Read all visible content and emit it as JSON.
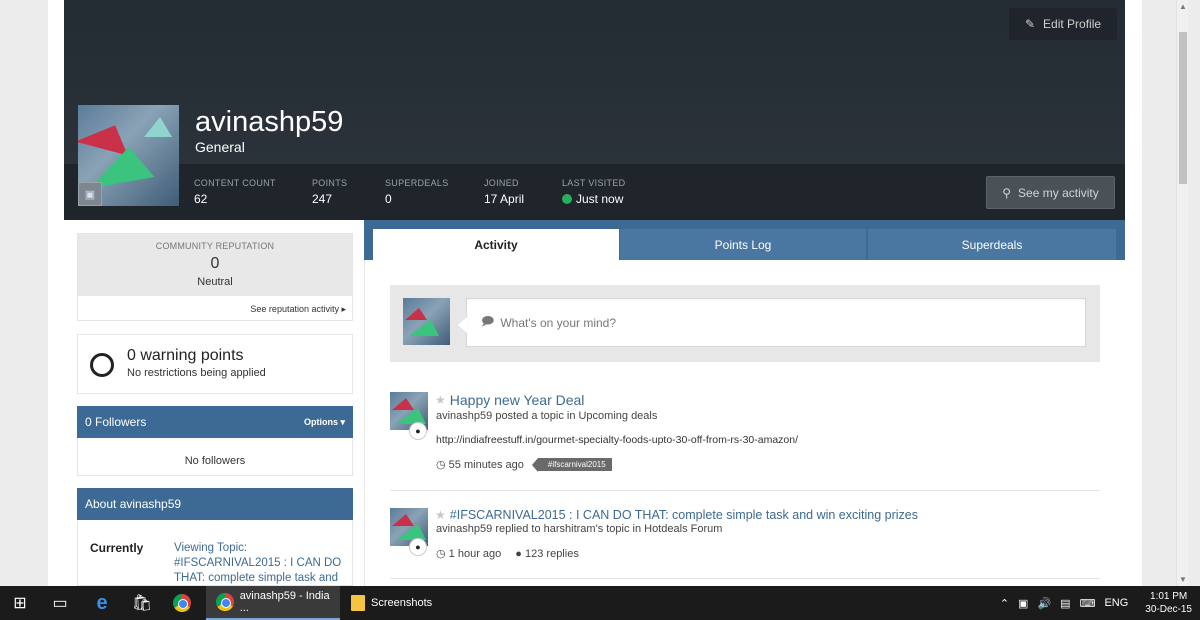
{
  "header": {
    "edit_profile": "Edit Profile",
    "username": "avinashp59",
    "usergroup": "General",
    "stats": [
      {
        "label": "CONTENT COUNT",
        "value": "62"
      },
      {
        "label": "POINTS",
        "value": "247"
      },
      {
        "label": "SUPERDEALS",
        "value": "0"
      },
      {
        "label": "JOINED",
        "value": "17 April"
      },
      {
        "label": "LAST VISITED",
        "value": "Just now"
      }
    ],
    "see_activity": "See my activity"
  },
  "reputation": {
    "title": "COMMUNITY REPUTATION",
    "score": "0",
    "status": "Neutral",
    "link": "See reputation activity ▸"
  },
  "warnings": {
    "title": "0 warning points",
    "subtitle": "No restrictions being applied"
  },
  "followers": {
    "title": "0 Followers",
    "options": "Options ▾",
    "empty": "No followers"
  },
  "about": {
    "title": "About avinashp59",
    "label": "Currently",
    "value": "Viewing Topic: #IFSCARNIVAL2015 : I CAN DO THAT: complete simple task and"
  },
  "tabs": [
    {
      "label": "Activity",
      "active": true
    },
    {
      "label": "Points Log",
      "active": false
    },
    {
      "label": "Superdeals",
      "active": false
    }
  ],
  "status_update": {
    "placeholder": "What's on your mind?"
  },
  "feed": [
    {
      "title": "Happy new Year Deal",
      "meta": "avinashp59 posted a topic in Upcoming deals",
      "url": "http://indiafreestuff.in/gourmet-specialty-foods-upto-30-off-from-rs-30-amazon/",
      "time": "55 minutes ago",
      "tag": "#ifscarnival2015"
    },
    {
      "title": "#IFSCARNIVAL2015 : I CAN DO THAT: complete simple task and win exciting prizes",
      "meta": "avinashp59 replied to harshitram's topic in Hotdeals Forum",
      "time": "1 hour ago",
      "replies": "123 replies"
    }
  ],
  "taskbar": {
    "apps": [
      {
        "label": "avinashp59 - India ...",
        "active": true
      },
      {
        "label": "Screenshots",
        "active": false
      }
    ],
    "language": "ENG",
    "time": "1:01 PM",
    "date": "30-Dec-15"
  },
  "colors": {
    "header_bg": "#2b3238",
    "accent_blue": "#3d6a94",
    "online_green": "#27ae60"
  }
}
